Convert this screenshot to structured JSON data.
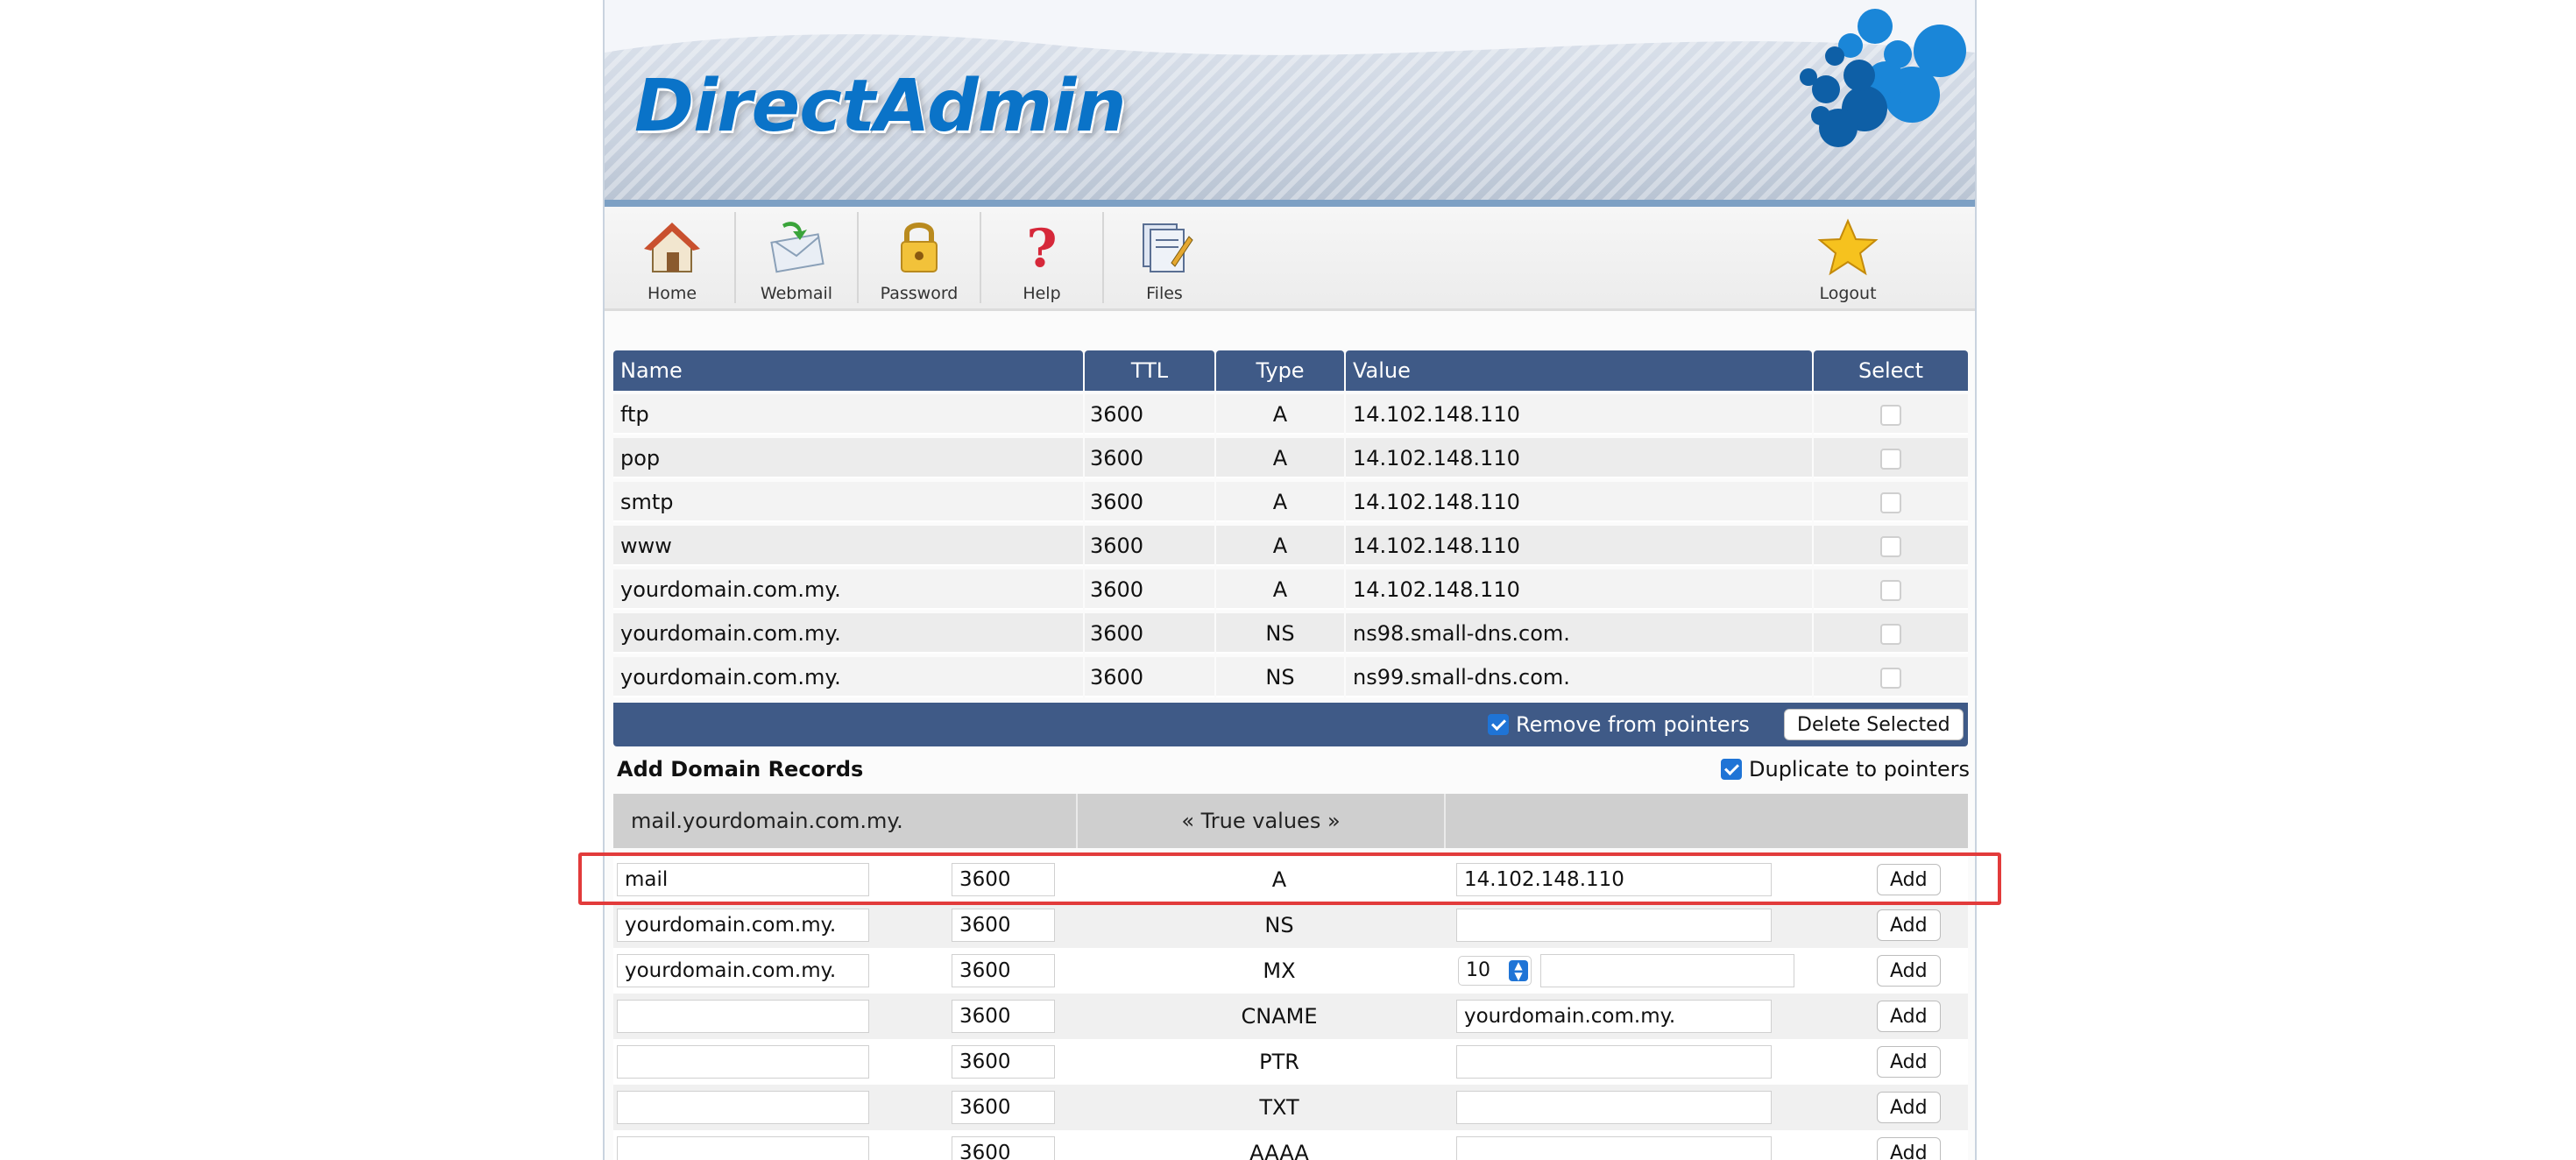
{
  "brand": {
    "logo_text": "DirectAdmin"
  },
  "toolbar": {
    "items": [
      {
        "label": "Home",
        "icon": "home-icon"
      },
      {
        "label": "Webmail",
        "icon": "webmail-icon"
      },
      {
        "label": "Password",
        "icon": "lock-icon"
      },
      {
        "label": "Help",
        "icon": "help-icon"
      },
      {
        "label": "Files",
        "icon": "files-icon"
      }
    ],
    "logout": {
      "label": "Logout",
      "icon": "star-icon"
    }
  },
  "records": {
    "headers": [
      "Name",
      "TTL",
      "Type",
      "Value",
      "Select"
    ],
    "rows": [
      {
        "name": "ftp",
        "ttl": "3600",
        "type": "A",
        "value": "14.102.148.110"
      },
      {
        "name": "pop",
        "ttl": "3600",
        "type": "A",
        "value": "14.102.148.110"
      },
      {
        "name": "smtp",
        "ttl": "3600",
        "type": "A",
        "value": "14.102.148.110"
      },
      {
        "name": "www",
        "ttl": "3600",
        "type": "A",
        "value": "14.102.148.110"
      },
      {
        "name": "yourdomain.com.my.",
        "ttl": "3600",
        "type": "A",
        "value": "14.102.148.110"
      },
      {
        "name": "yourdomain.com.my.",
        "ttl": "3600",
        "type": "NS",
        "value": "ns98.small-dns.com."
      },
      {
        "name": "yourdomain.com.my.",
        "ttl": "3600",
        "type": "NS",
        "value": "ns99.small-dns.com."
      }
    ],
    "remove_from_pointers": "Remove from pointers",
    "delete_selected": "Delete Selected"
  },
  "add_records": {
    "title": "Add Domain Records",
    "duplicate_to_pointers": "Duplicate to pointers",
    "subheader": {
      "domain": "mail.yourdomain.com.my.",
      "true_values": "« True values »"
    },
    "add_label": "Add",
    "rows": [
      {
        "name": "mail",
        "ttl": "3600",
        "type": "A",
        "value": "14.102.148.110"
      },
      {
        "name": "yourdomain.com.my.",
        "ttl": "3600",
        "type": "NS",
        "value": ""
      },
      {
        "name": "yourdomain.com.my.",
        "ttl": "3600",
        "type": "MX",
        "priority": "10",
        "value": ""
      },
      {
        "name": "",
        "ttl": "3600",
        "type": "CNAME",
        "value": "yourdomain.com.my."
      },
      {
        "name": "",
        "ttl": "3600",
        "type": "PTR",
        "value": ""
      },
      {
        "name": "",
        "ttl": "3600",
        "type": "TXT",
        "value": ""
      },
      {
        "name": "",
        "ttl": "3600",
        "type": "AAAA",
        "value": ""
      }
    ]
  },
  "colors": {
    "header_blue": "#3f5a87",
    "highlight_red": "#e23b3b",
    "logo_blue": "#0a73c8"
  }
}
